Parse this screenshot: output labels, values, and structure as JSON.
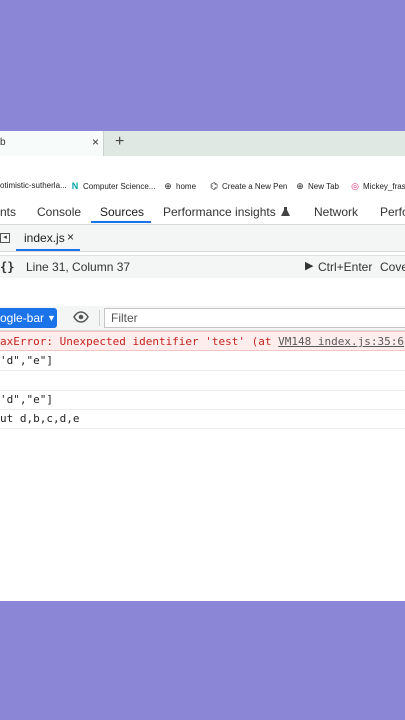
{
  "browser": {
    "tab_title": "b",
    "tab_close": "×",
    "new_tab": "+"
  },
  "bookmarks": [
    {
      "label": "otimistic-sutherla...",
      "icon": ""
    },
    {
      "label": "Computer Science...",
      "icon": "N"
    },
    {
      "label": "home",
      "icon": "⊕"
    },
    {
      "label": "Create a New Pen",
      "icon": "⌬"
    },
    {
      "label": "New Tab",
      "icon": "⊕"
    },
    {
      "label": "Mickey_fras",
      "icon": "◎"
    }
  ],
  "devtools": {
    "tabs": [
      "nts",
      "Console",
      "Sources",
      "Performance insights",
      "Network",
      "Perfo"
    ],
    "performance_icon": "flask-icon",
    "active_tab": "Sources"
  },
  "sources": {
    "file_name": "index.js",
    "file_close": "×",
    "braces": "{}",
    "cursor_position": "Line 31, Column 37",
    "run_label": "Ctrl+Enter",
    "coverage_label": "Cove"
  },
  "console": {
    "context": "ogle-bar",
    "filter_placeholder": "Filter",
    "error_text": "axError: Unexpected identifier 'test' (at ",
    "error_link": "VM148 index.js:35:6",
    "error_suffix": ")",
    "lines": [
      "'d\",\"e\"]",
      "",
      "'d\",\"e\"]",
      "ut d,b,c,d,e"
    ]
  },
  "colors": {
    "background": "#8b87d6",
    "accent": "#1a73e8",
    "error": "#c5221f",
    "error_bg": "#fdeded"
  }
}
